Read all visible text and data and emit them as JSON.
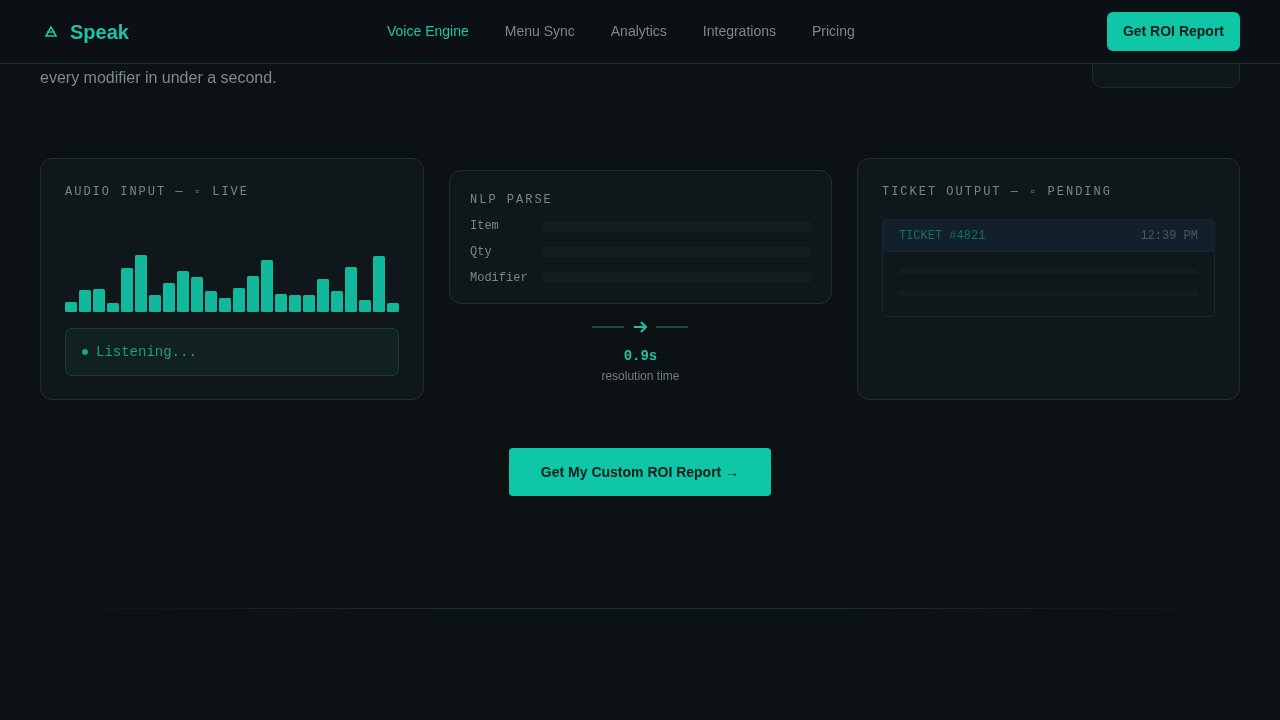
{
  "header": {
    "brand": "Speak",
    "nav": [
      {
        "label": "Voice Engine",
        "selected": true
      },
      {
        "label": "Menu Sync",
        "selected": false
      },
      {
        "label": "Analytics",
        "selected": false
      },
      {
        "label": "Integrations",
        "selected": false
      },
      {
        "label": "Pricing",
        "selected": false
      }
    ],
    "cta": "Get ROI Report"
  },
  "hero": {
    "text": "every modifier in under a second."
  },
  "audio_panel": {
    "title": "AUDIO INPUT — ▫ LIVE",
    "status": "Listening..."
  },
  "nlp_panel": {
    "title": "NLP PARSE",
    "fields": [
      "Item",
      "Qty",
      "Modifier"
    ]
  },
  "flow": {
    "value": "0.9s",
    "caption": "resolution time"
  },
  "ticket_panel": {
    "title": "TICKET OUTPUT — ▫ PENDING",
    "ticket": "TICKET #4821",
    "time": "12:39 PM"
  },
  "cta_button": "Get My Custom ROI Report →"
}
